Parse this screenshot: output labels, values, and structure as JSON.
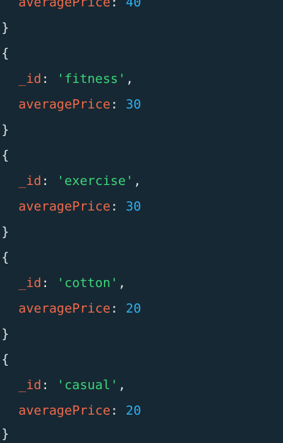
{
  "theme": {
    "background": "#162833",
    "punctuation": "#e6e6e6",
    "key": "#f26a4b",
    "string": "#3bd67a",
    "number": "#2fb0f0"
  },
  "output": {
    "first_partial": {
      "key": "averagePrice",
      "sep": ": ",
      "value": "40"
    },
    "open_brace": "{",
    "close_brace": "}",
    "id_key": "_id",
    "price_key": "averagePrice",
    "sep": ": ",
    "comma": ",",
    "documents": [
      {
        "id": "'fitness'",
        "averagePrice": "30"
      },
      {
        "id": "'exercise'",
        "averagePrice": "30"
      },
      {
        "id": "'cotton'",
        "averagePrice": "20"
      },
      {
        "id": "'casual'",
        "averagePrice": "20"
      }
    ]
  }
}
